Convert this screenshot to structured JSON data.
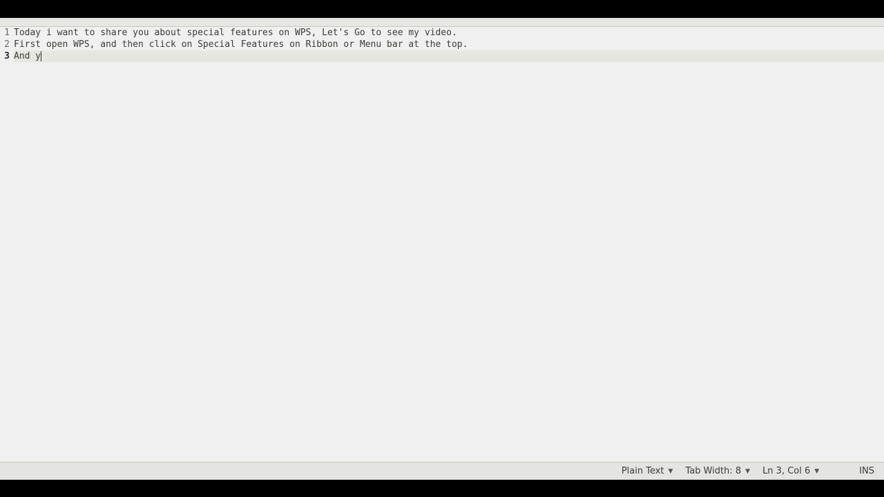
{
  "editor": {
    "lines": [
      {
        "num": "1",
        "text": "Today i want to share you about special features on WPS, Let's Go to see my video.",
        "current": false
      },
      {
        "num": "2",
        "text": "First open WPS, and then click on Special Features on Ribbon or Menu bar at the top.",
        "current": false
      },
      {
        "num": "3",
        "text": "And y",
        "current": true
      }
    ],
    "cursor_line_index": 2
  },
  "statusbar": {
    "language": "Plain Text",
    "tab_width": "Tab Width: 8",
    "position": "Ln 3, Col 6",
    "insert_mode": "INS"
  }
}
